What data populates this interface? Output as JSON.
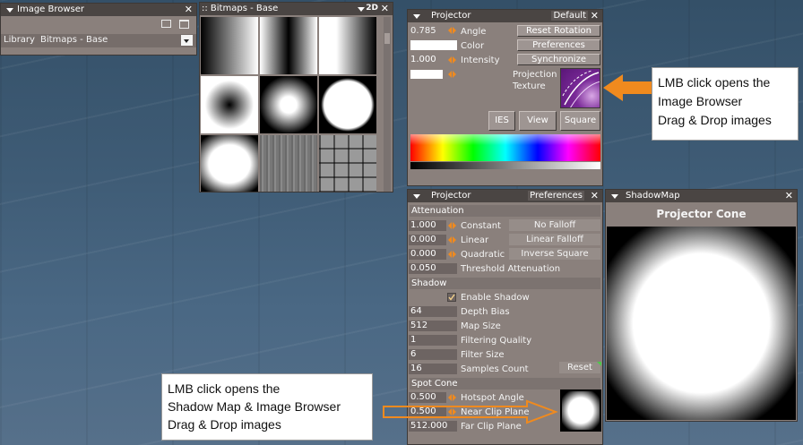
{
  "image_browser": {
    "title": "Image Browser",
    "library_label": "Library",
    "library_value": "Bitmaps - Base",
    "close": "✕"
  },
  "bitmaps": {
    "title": ":: Bitmaps - Base",
    "badge": "2D",
    "close": "✕"
  },
  "projector": {
    "title": "Projector",
    "preset": "Default",
    "close": "✕",
    "angle_value": "0.785",
    "angle_label": "Angle",
    "color_label": "Color",
    "intensity_value": "1.000",
    "intensity_label": "Intensity",
    "reset_rotation": "Reset Rotation",
    "preferences": "Preferences",
    "synchronize": "Synchronize",
    "projection_texture_label_1": "Projection",
    "projection_texture_label_2": "Texture",
    "ies": "IES",
    "view": "View",
    "square": "Square"
  },
  "projector2": {
    "title": "Projector",
    "preferences": "Preferences",
    "close": "✕",
    "attenuation": "Attenuation",
    "constant_value": "1.000",
    "constant_label": "Constant",
    "no_falloff": "No Falloff",
    "linear_value": "0.000",
    "linear_label": "Linear",
    "linear_falloff": "Linear Falloff",
    "quadratic_value": "0.000",
    "quadratic_label": "Quadratic",
    "inverse_square": "Inverse Square",
    "threshold_value": "0.050",
    "threshold_label": "Threshold Attenuation",
    "shadow": "Shadow",
    "enable_shadow_label": "Enable Shadow",
    "enable_shadow_checked": true,
    "depth_bias_value": "64",
    "depth_bias_label": "Depth Bias",
    "map_size_value": "512",
    "map_size_label": "Map Size",
    "filtering_value": "1",
    "filtering_label": "Filtering Quality",
    "filter_size_value": "6",
    "filter_size_label": "Filter Size",
    "samples_value": "16",
    "samples_label": "Samples Count",
    "reset": "Reset",
    "spot_cone": "Spot Cone",
    "hotspot_value": "0.500",
    "hotspot_label": "Hotspot Angle",
    "near_value": "0.500",
    "near_label": "Near Clip Plane",
    "far_value": "512.000",
    "far_label": "Far Clip Plane"
  },
  "shadowmap": {
    "title": "ShadowMap",
    "close": "✕",
    "heading": "Projector Cone"
  },
  "callout_right": {
    "line1": "LMB click opens the",
    "line2": "Image Browser",
    "line3": "Drag & Drop images"
  },
  "callout_bottom": {
    "line1": "LMB click opens the",
    "line2": "Shadow Map & Image Browser",
    "line3": "Drag & Drop images"
  },
  "colors": {
    "accent": "#f08a1e",
    "panel": "#8a807c",
    "titlebar": "#4a4543"
  }
}
